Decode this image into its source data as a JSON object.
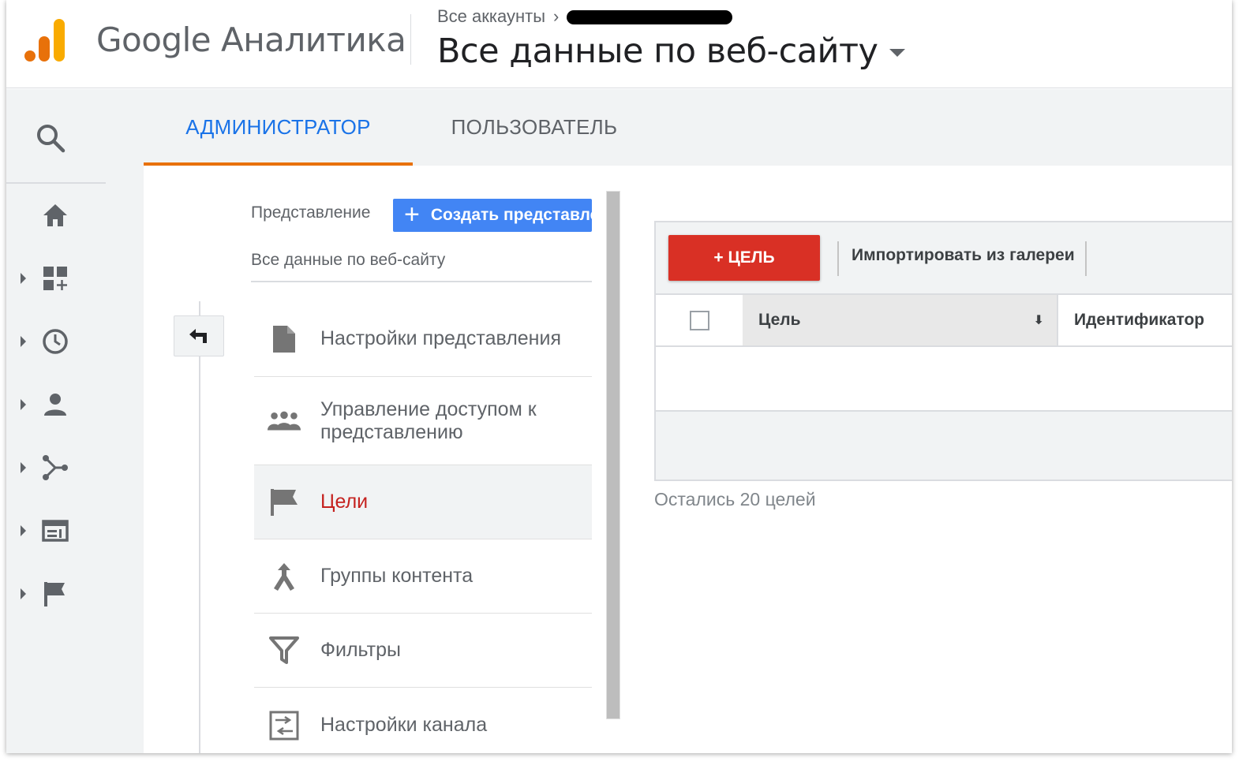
{
  "header": {
    "app_name": "Google Аналитика",
    "breadcrumb": "Все аккаунты",
    "view_title": "Все данные по веб-сайту"
  },
  "tabs": [
    {
      "label": "АДМИНИСТРАТОР",
      "active": true
    },
    {
      "label": "ПОЛЬЗОВАТЕЛЬ",
      "active": false
    }
  ],
  "rail": {
    "items": [
      "search-icon",
      "home-icon",
      "customization-icon",
      "realtime-icon",
      "audience-icon",
      "acquisition-icon",
      "behavior-icon",
      "conversions-icon"
    ]
  },
  "view_column": {
    "label": "Представление",
    "create_button": "Создать представление",
    "selected_view": "Все данные по веб-сайту",
    "menu": [
      {
        "label": "Настройки представления",
        "icon": "document-icon",
        "active": false
      },
      {
        "label": "Управление доступом к представлению",
        "icon": "people-icon",
        "active": false
      },
      {
        "label": "Цели",
        "icon": "flag-icon",
        "active": true
      },
      {
        "label": "Группы контента",
        "icon": "merge-icon",
        "active": false
      },
      {
        "label": "Фильтры",
        "icon": "filter-icon",
        "active": false
      },
      {
        "label": "Настройки канала",
        "icon": "channel-settings-icon",
        "active": false
      }
    ]
  },
  "goals": {
    "add_button": "+ ЦЕЛЬ",
    "import_button": "Импортировать из галереи",
    "columns": [
      "Цель",
      "Идентификатор"
    ],
    "remaining": "Остались 20 целей"
  },
  "colors": {
    "accent_blue": "#1a73e8",
    "tab_underline": "#e8710a",
    "add_goal_red": "#d93025",
    "create_button_blue": "#4285f4"
  }
}
